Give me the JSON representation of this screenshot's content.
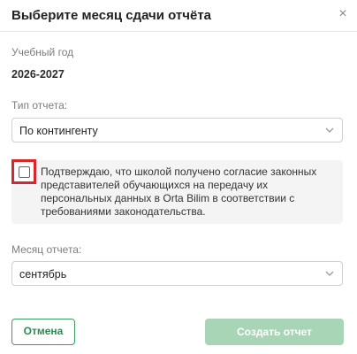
{
  "dialog": {
    "title": "Выберите месяц сдачи отчёта",
    "close_symbol": "×"
  },
  "academic_year": {
    "label": "Учебный год",
    "value": "2026-2027"
  },
  "report_type": {
    "label": "Тип отчета:",
    "selected": "По контингенту"
  },
  "consent": {
    "checked": false,
    "text": "Подтверждаю, что школой получено согласие законных представителей обучающихся на передачу их персональных данных в Orta Bilim в соответствии с требованиями законодательства."
  },
  "report_month": {
    "label": "Месяц отчета:",
    "selected": "сентябрь"
  },
  "actions": {
    "cancel_label": "Отмена",
    "create_label": "Создать отчет"
  },
  "colors": {
    "primary": "#3f9b63",
    "primary_disabled": "#a9d5b7",
    "highlight": "#d8262b"
  },
  "icons": {
    "close": "close-icon",
    "dropdown": "chevron-down-icon"
  }
}
